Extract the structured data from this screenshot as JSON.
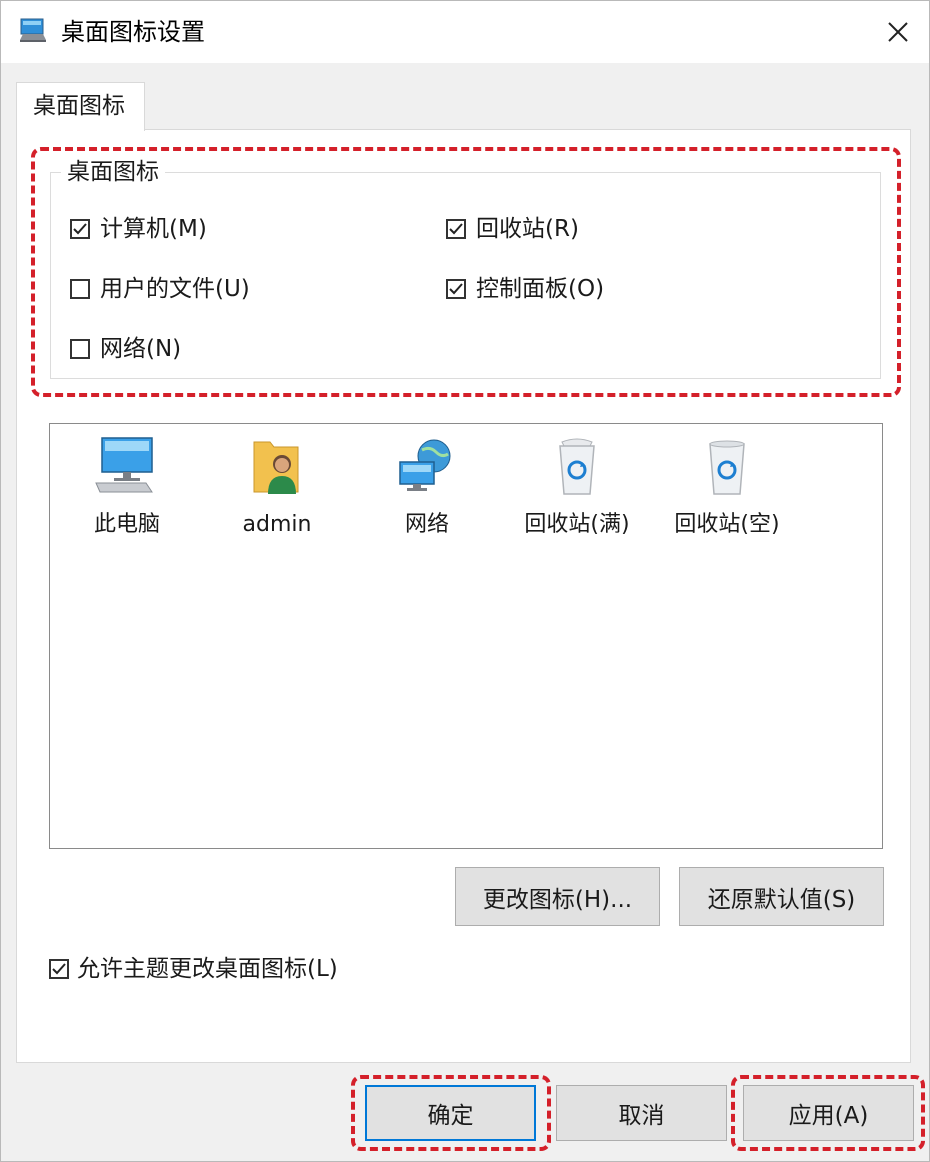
{
  "window": {
    "title": "桌面图标设置",
    "app_icon": "desktop-settings-icon",
    "close_icon": "close-icon"
  },
  "tabs": [
    {
      "label": "桌面图标",
      "selected": true
    }
  ],
  "desktop_icons_group": {
    "legend": "桌面图标",
    "checkboxes": [
      {
        "label": "计算机(M)",
        "checked": true
      },
      {
        "label": "回收站(R)",
        "checked": true
      },
      {
        "label": "用户的文件(U)",
        "checked": false
      },
      {
        "label": "控制面板(O)",
        "checked": true
      },
      {
        "label": "网络(N)",
        "checked": false
      }
    ]
  },
  "icon_list": {
    "items": [
      {
        "label": "此电脑",
        "icon": "computer-icon"
      },
      {
        "label": "admin",
        "icon": "user-folder-icon"
      },
      {
        "label": "网络",
        "icon": "network-icon"
      },
      {
        "label": "回收站(满)",
        "icon": "recycle-bin-full-icon"
      },
      {
        "label": "回收站(空)",
        "icon": "recycle-bin-empty-icon"
      }
    ]
  },
  "icon_actions": {
    "change_icon_label": "更改图标(H)...",
    "restore_default_label": "还原默认值(S)"
  },
  "allow_themes": {
    "label": "允许主题更改桌面图标(L)",
    "checked": true
  },
  "footer": {
    "ok_label": "确定",
    "cancel_label": "取消",
    "apply_label": "应用(A)"
  },
  "colors": {
    "highlight": "#d4202a",
    "focus": "#0078d7"
  }
}
